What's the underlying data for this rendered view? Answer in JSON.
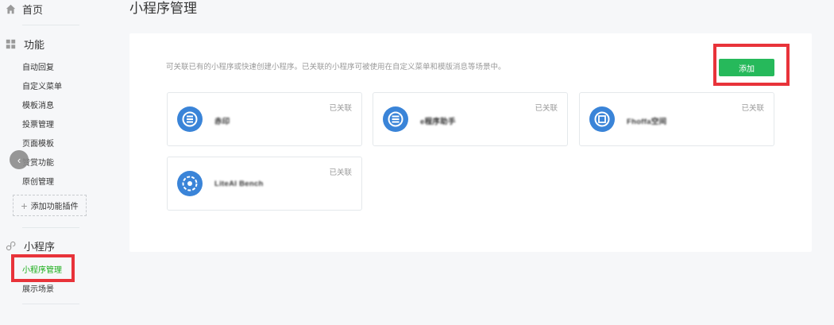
{
  "sidebar": {
    "home_label": "首页",
    "features": {
      "title": "功能",
      "items": [
        "自动回复",
        "自定义菜单",
        "模板消息",
        "投票管理",
        "页面模板",
        "赞赏功能",
        "原创管理"
      ],
      "add_plugin_label": "添加功能插件"
    },
    "miniprogram": {
      "title": "小程序",
      "items": [
        {
          "label": "小程序管理",
          "active": true
        },
        {
          "label": "展示场景",
          "active": false
        }
      ]
    }
  },
  "main": {
    "page_title": "小程序管理",
    "description": "可关联已有的小程序或快速创建小程序。已关联的小程序可被使用在自定义菜单和模版消息等场景中。",
    "add_button_label": "添加",
    "apps": [
      {
        "name": "赤印",
        "status": "已关联"
      },
      {
        "name": "e程序助手",
        "status": "已关联"
      },
      {
        "name": "Fhoffa空间",
        "status": "已关联"
      },
      {
        "name": "LiteAI Bench",
        "status": "已关联"
      }
    ]
  },
  "colors": {
    "accent_green": "#1aad19",
    "button_green": "#26b95b",
    "highlight_red": "#e8333a",
    "app_icon_blue": "#3a84d8"
  }
}
